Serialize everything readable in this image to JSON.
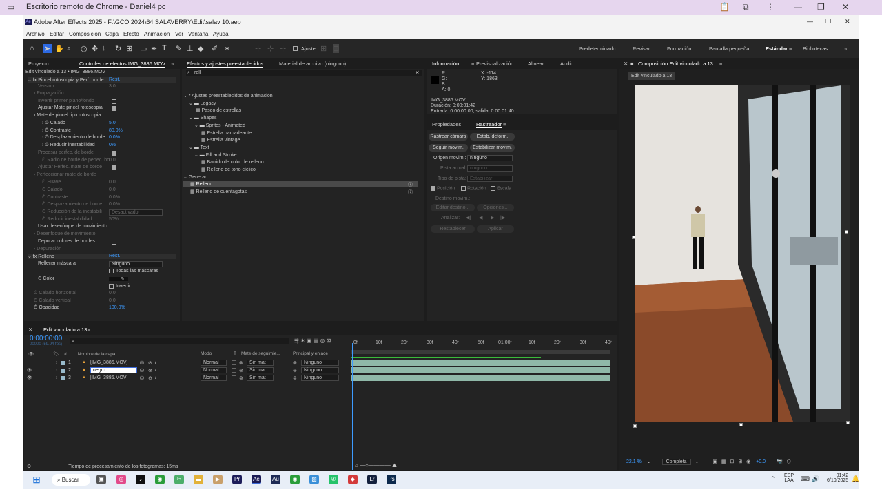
{
  "chrome": {
    "title": "Escritorio remoto de Chrome - Daniel4 pc"
  },
  "app": {
    "title": "Adobe After Effects 2025 - F:\\GCO 2024\\64 SALAVERRY\\Edit\\salav 10.aep",
    "menu": [
      "Archivo",
      "Editar",
      "Composición",
      "Capa",
      "Efecto",
      "Animación",
      "Ver",
      "Ventana",
      "Ayuda"
    ],
    "snap_label": "Ajuste",
    "workspaces": [
      "Predeterminado",
      "Revisar",
      "Formación",
      "Pantalla pequeña",
      "Estándar",
      "Bibliotecas"
    ]
  },
  "effects_controls": {
    "tab_project": "Proyecto",
    "tab": "Controles de efectos IMG_3886.MOV",
    "subtitle": "Edit vinculado a 13 • IMG_3886.MOV",
    "rows": [
      {
        "label": "Pincel rotoscopia y Perf. borde",
        "value": "Rest."
      },
      {
        "label": "Versión",
        "value": "3.0"
      },
      {
        "label": "Propagación",
        "value": ""
      },
      {
        "label": "Invertir primer plano/fondo",
        "value": ""
      },
      {
        "label": "Ajustar Mate pincel rotoscopia",
        "value": ""
      },
      {
        "label": "Mate de pincel tipo rotoscopia",
        "value": ""
      },
      {
        "label": "Calado",
        "value": "5.0"
      },
      {
        "label": "Contraste",
        "value": "80.0%"
      },
      {
        "label": "Desplazamiento de borde",
        "value": "0.0%"
      },
      {
        "label": "Reducir inestabilidad",
        "value": "0%"
      },
      {
        "label": "Procesar perfec. de borde",
        "value": ""
      },
      {
        "label": "Radio de borde de perfec. bo",
        "value": "0.0"
      },
      {
        "label": "Ajustar Perfec. mate de borde",
        "value": ""
      },
      {
        "label": "Perfeccionar mate de borde",
        "value": ""
      },
      {
        "label": "Suave",
        "value": "0.0"
      },
      {
        "label": "Calado",
        "value": "0.0"
      },
      {
        "label": "Contraste",
        "value": "0.0%"
      },
      {
        "label": "Desplazamiento de borde",
        "value": "0.0%"
      },
      {
        "label": "Reducción de la inestabili",
        "value": "Desactivado"
      },
      {
        "label": "Reducir inestabilidad",
        "value": "50%"
      },
      {
        "label": "Usar desenfoque de movimiento",
        "value": ""
      },
      {
        "label": "Desenfoque de movimiento",
        "value": ""
      },
      {
        "label": "Depurar colores de bordes",
        "value": ""
      },
      {
        "label": "Depuración",
        "value": ""
      },
      {
        "label": "Relleno",
        "value": "Rest."
      },
      {
        "label": "Rellenar máscara",
        "value": "Ninguno"
      },
      {
        "label": "",
        "value": "Todas las máscaras"
      },
      {
        "label": "Color",
        "value": ""
      },
      {
        "label": "",
        "value": "Invertir"
      },
      {
        "label": "Calado horizontal",
        "value": "0.0"
      },
      {
        "label": "Calado vertical",
        "value": "0.0"
      },
      {
        "label": "Opacidad",
        "value": "100.0%"
      }
    ]
  },
  "presets": {
    "tab": "Efectos y ajustes preestablecidos",
    "tab2": "Material de archivo (ninguno)",
    "search": "rell",
    "tree": [
      {
        "label": "* Ajustes preestablecidos de animación",
        "lvl": 0,
        "icon": "arrow"
      },
      {
        "label": "Legacy",
        "lvl": 1,
        "icon": "folder"
      },
      {
        "label": "Paseo de estrellas",
        "lvl": 2,
        "icon": "file"
      },
      {
        "label": "Shapes",
        "lvl": 1,
        "icon": "folder"
      },
      {
        "label": "Sprites - Animated",
        "lvl": 2,
        "icon": "folder"
      },
      {
        "label": "Estrella parpadeante",
        "lvl": 3,
        "icon": "file"
      },
      {
        "label": "Estrella vintage",
        "lvl": 3,
        "icon": "file"
      },
      {
        "label": "Text",
        "lvl": 1,
        "icon": "folder"
      },
      {
        "label": "Fill and Stroke",
        "lvl": 2,
        "icon": "folder"
      },
      {
        "label": "Barrido de color de relleno",
        "lvl": 3,
        "icon": "file"
      },
      {
        "label": "Relleno de tono cíclico",
        "lvl": 3,
        "icon": "file"
      },
      {
        "label": "Generar",
        "lvl": 0,
        "icon": "arrow"
      },
      {
        "label": "Relleno",
        "lvl": 1,
        "icon": "file"
      },
      {
        "label": "Relleno de cuentagotas",
        "lvl": 1,
        "icon": "file"
      }
    ]
  },
  "info": {
    "tabs": [
      "Información",
      "Previsualización",
      "Alinear",
      "Audio"
    ],
    "r": "R:",
    "g": "G:",
    "b": "B:",
    "a": "A:  0",
    "x": "X:  -114",
    "y": "Y:  1863",
    "file": "IMG_3886.MOV",
    "duration": "Duración: 0:00:01:42",
    "inout": "Entrada: 0:00:00:00, salida: 0:00:01:40"
  },
  "tracker": {
    "tabs": [
      "Propiedades",
      "Rastreador"
    ],
    "btn_camera": "Rastrear cámara",
    "btn_warp": "Estab. deform.",
    "btn_track": "Seguir movim.",
    "btn_stab": "Estabilizar movim.",
    "source_label": "Origen movim.:",
    "source_value": "ninguno",
    "current_label": "Pista actual:",
    "current_value": "ninguno",
    "type_label": "Tipo de pista:",
    "type_value": "Estabilizar",
    "pos": "Posición",
    "rot": "Rotación",
    "scale": "Escala",
    "dest": "Destino movim.:",
    "edit_target": "Editar destino...",
    "options": "Opciones...",
    "analyze": "Analizar:",
    "reset": "Restablecer",
    "apply": "Aplicar"
  },
  "composition": {
    "tab": "Composición Edit vinculado a 13",
    "tag": "Edit vinculado a 13",
    "zoom": "22.1 %",
    "res": "Completa",
    "exposure": "+0.0"
  },
  "timeline": {
    "tab": "Edit vinculado a 13",
    "timecode": "0:00:00:00",
    "fps": "00000 (59.94 fps)",
    "headers": {
      "num": "#",
      "name": "Nombre de la capa",
      "mode": "Modo",
      "t": "T",
      "track": "Mate de seguimie...",
      "parent": "Principal y enlace"
    },
    "layers": [
      {
        "num": "1",
        "name": "[IMG_3886.MOV]",
        "mode": "Normal",
        "track": "Sin mat",
        "parent": "Ninguno"
      },
      {
        "num": "2",
        "name": "negro",
        "mode": "Normal",
        "track": "Sin mat",
        "parent": "Ninguno"
      },
      {
        "num": "3",
        "name": "[IMG_3886.MOV]",
        "mode": "Normal",
        "track": "Sin mat",
        "parent": "Ninguno"
      }
    ],
    "ruler": [
      "0f",
      "10f",
      "20f",
      "30f",
      "40f",
      "50f",
      "01:00f",
      "10f",
      "20f",
      "30f",
      "40f"
    ],
    "status": "Tiempo de procesamiento de los fotogramas: 15ms"
  },
  "taskbar": {
    "search": "Buscar",
    "lang1": "ESP",
    "lang2": "LAA",
    "time": "01:42",
    "date": "6/10/2025"
  }
}
